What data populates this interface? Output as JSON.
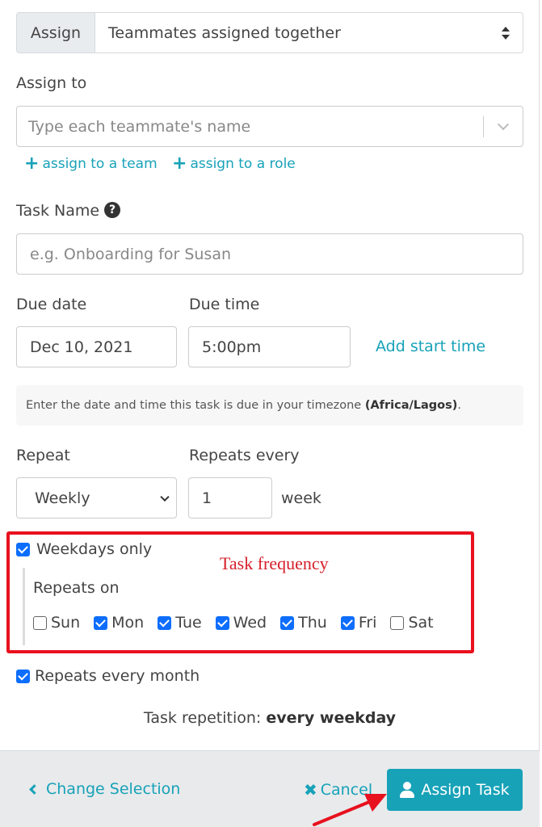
{
  "assign": {
    "addon_label": "Assign",
    "selected": "Teammates assigned together"
  },
  "assign_to": {
    "label": "Assign to",
    "placeholder": "Type each teammate's name",
    "assign_team_link": "assign to a team",
    "assign_role_link": "assign to a role"
  },
  "task_name": {
    "label": "Task Name",
    "help_glyph": "?",
    "placeholder": "e.g. Onboarding for Susan"
  },
  "due": {
    "date_label": "Due date",
    "date_value": "Dec 10, 2021",
    "time_label": "Due time",
    "time_value": "5:00pm",
    "add_start_time": "Add start time",
    "info_prefix": "Enter the date and time this task is due in your timezone ",
    "info_timezone": "(Africa/Lagos)",
    "info_suffix": "."
  },
  "repeat": {
    "label": "Repeat",
    "selected": "Weekly",
    "every_label": "Repeats every",
    "every_value": "1",
    "unit": "week"
  },
  "frequency": {
    "annotation": "Task frequency",
    "weekdays_only_label": "Weekdays only",
    "weekdays_only_checked": true,
    "repeats_on_label": "Repeats on",
    "days": [
      {
        "label": "Sun",
        "checked": false
      },
      {
        "label": "Mon",
        "checked": true
      },
      {
        "label": "Tue",
        "checked": true
      },
      {
        "label": "Wed",
        "checked": true
      },
      {
        "label": "Thu",
        "checked": true
      },
      {
        "label": "Fri",
        "checked": true
      },
      {
        "label": "Sat",
        "checked": false
      }
    ]
  },
  "repeats_every_month": {
    "label": "Repeats every month",
    "checked": true
  },
  "summary": {
    "prefix": "Task repetition: ",
    "value": "every weekday"
  },
  "footer": {
    "change_selection": "Change Selection",
    "cancel": "Cancel",
    "cancel_glyph": "✖",
    "assign_task": "Assign Task"
  },
  "colors": {
    "accent": "#17a2b8",
    "checkbox": "#0d6efd",
    "annotation_red": "#e8111e"
  }
}
